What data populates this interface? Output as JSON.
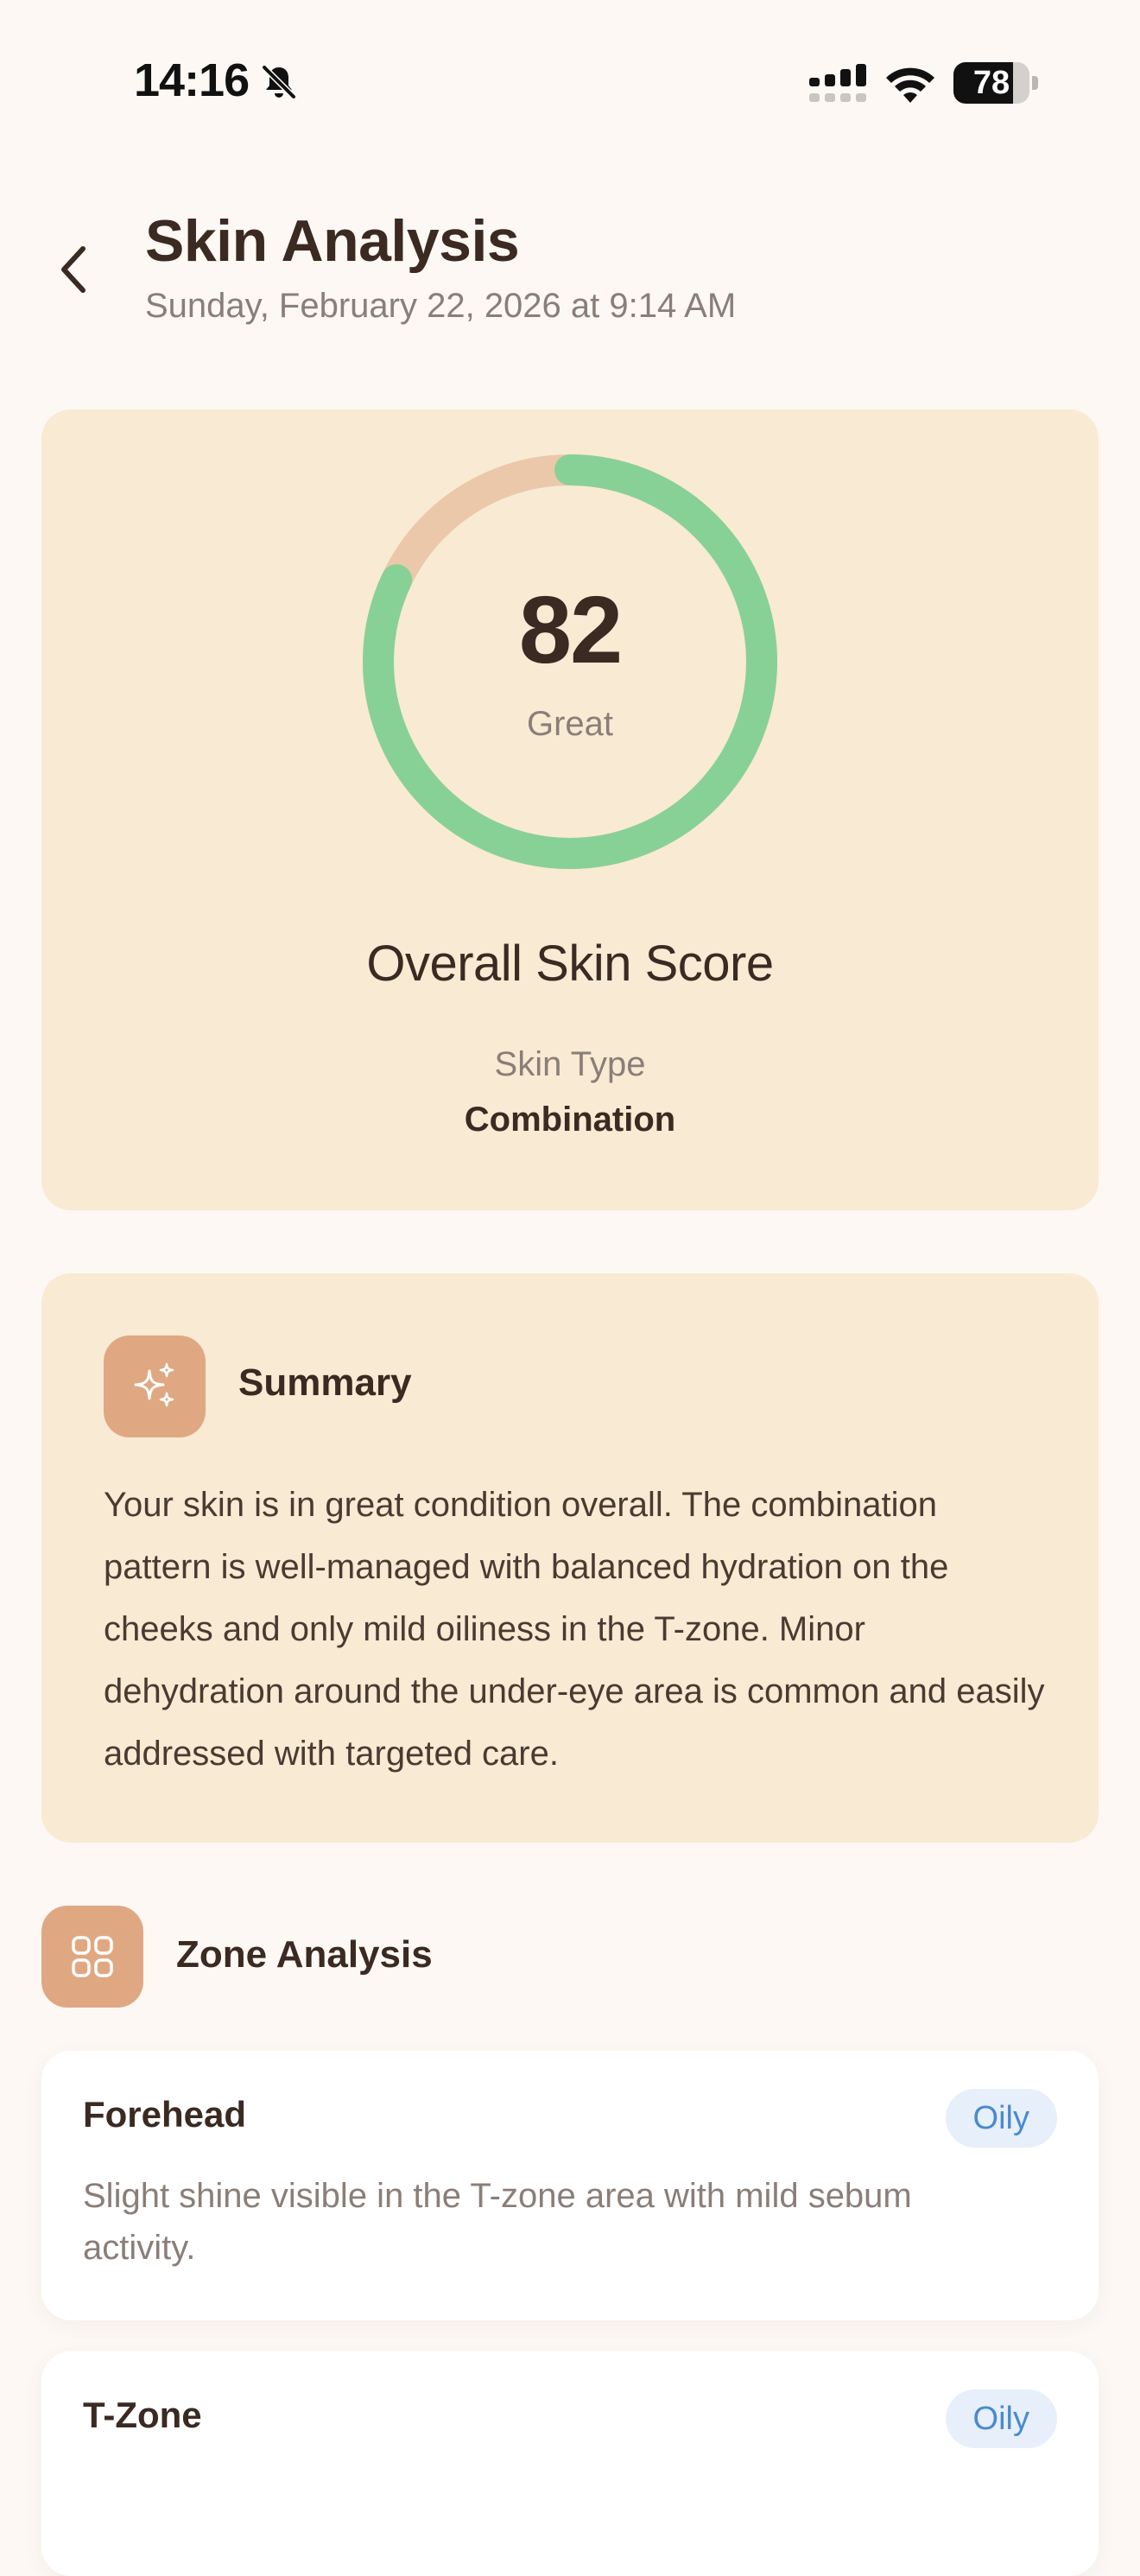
{
  "status_bar": {
    "time": "14:16",
    "battery_level": "78",
    "battery_fraction": 0.78
  },
  "header": {
    "title": "Skin Analysis",
    "subtitle": "Sunday, February 22, 2026 at 9:14 AM"
  },
  "score_card": {
    "score": "82",
    "score_fraction": 0.82,
    "score_label": "Great",
    "title": "Overall Skin Score",
    "skin_type_label": "Skin Type",
    "skin_type_value": "Combination"
  },
  "summary": {
    "title": "Summary",
    "text": "Your skin is in great condition overall. The combination pattern is well-managed with balanced hydration on the cheeks and only mild oiliness in the T-zone. Minor dehydration around the under-eye area is common and easily addressed with targeted care."
  },
  "zone_analysis": {
    "title": "Zone Analysis",
    "zones": [
      {
        "name": "Forehead",
        "badge": "Oily",
        "description": "Slight shine visible in the T-zone area with mild sebum activity."
      },
      {
        "name": "T-Zone",
        "badge": "Oily"
      }
    ]
  },
  "colors": {
    "background": "#fdf8f4",
    "card": "#f9ead3",
    "gauge_fill": "#88d196",
    "gauge_track": "#ecc8aa",
    "accent_tile": "#e0a882",
    "badge_bg": "#e7effa",
    "badge_text": "#4a8ad0"
  },
  "icons": {
    "back": "chevron-left-icon",
    "summary": "sparkles-icon",
    "zone": "grid-icon",
    "status_bell": "bell-slash-icon",
    "status_signal": "cellular-signal-icon",
    "status_wifi": "wifi-icon"
  }
}
